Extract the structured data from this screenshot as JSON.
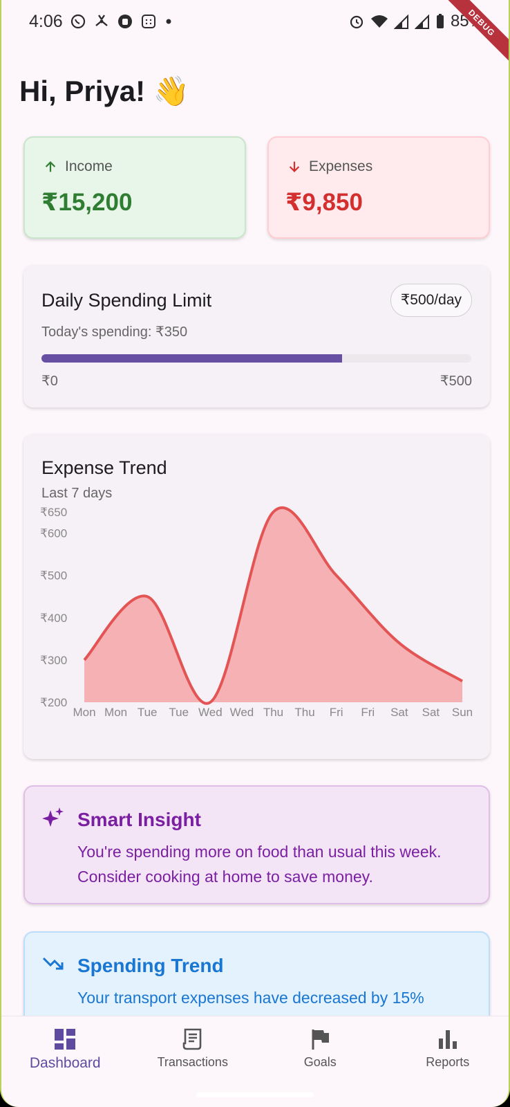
{
  "status_bar": {
    "time": "4:06",
    "battery": "85%"
  },
  "debug_ribbon": "DEBUG",
  "greeting": "Hi, Priya! 👋",
  "summary": {
    "income": {
      "label": "Income",
      "value": "₹15,200"
    },
    "expenses": {
      "label": "Expenses",
      "value": "₹9,850"
    }
  },
  "daily_limit": {
    "title": "Daily Spending Limit",
    "badge": "₹500/day",
    "subtitle": "Today's spending: ₹350",
    "progress_fraction": 0.7,
    "min_label": "₹0",
    "max_label": "₹500"
  },
  "expense_trend": {
    "title": "Expense Trend",
    "subtitle": "Last 7 days"
  },
  "chart_data": {
    "type": "area",
    "title": "Expense Trend",
    "subtitle": "Last 7 days",
    "x_tick_labels": [
      "Mon",
      "Mon",
      "Tue",
      "Tue",
      "Wed",
      "Wed",
      "Thu",
      "Thu",
      "Fri",
      "Fri",
      "Sat",
      "Sat",
      "Sun"
    ],
    "y_tick_labels": [
      "₹200",
      "₹300",
      "₹400",
      "₹500",
      "₹600",
      "₹650"
    ],
    "y_ticks": [
      200,
      300,
      400,
      500,
      600,
      650
    ],
    "ylim": [
      200,
      650
    ],
    "points": [
      {
        "x": 0,
        "y": 300
      },
      {
        "x": 2,
        "y": 450
      },
      {
        "x": 4,
        "y": 200
      },
      {
        "x": 6,
        "y": 650
      },
      {
        "x": 8,
        "y": 500
      },
      {
        "x": 10,
        "y": 340
      },
      {
        "x": 12,
        "y": 250
      }
    ],
    "line_color": "#e35454",
    "fill_color": "#f5b1b4",
    "grid": false
  },
  "insights": [
    {
      "icon": "sparkle-icon",
      "title": "Smart Insight",
      "body": "You're spending more on food than usual this week. Consider cooking at home to save money."
    },
    {
      "icon": "trending-down-icon",
      "title": "Spending Trend",
      "body": "Your transport expenses have decreased by 15%"
    }
  ],
  "bottom_nav": {
    "items": [
      {
        "label": "Dashboard",
        "icon": "dashboard-icon",
        "active": true
      },
      {
        "label": "Transactions",
        "icon": "receipt-icon",
        "active": false
      },
      {
        "label": "Goals",
        "icon": "flag-icon",
        "active": false
      },
      {
        "label": "Reports",
        "icon": "bar-chart-icon",
        "active": false
      }
    ]
  },
  "colors": {
    "income": "#2e7d32",
    "expense": "#d32f2f",
    "accent": "#6750a4",
    "insight": "#7b1fa2",
    "trend": "#1976d2"
  }
}
